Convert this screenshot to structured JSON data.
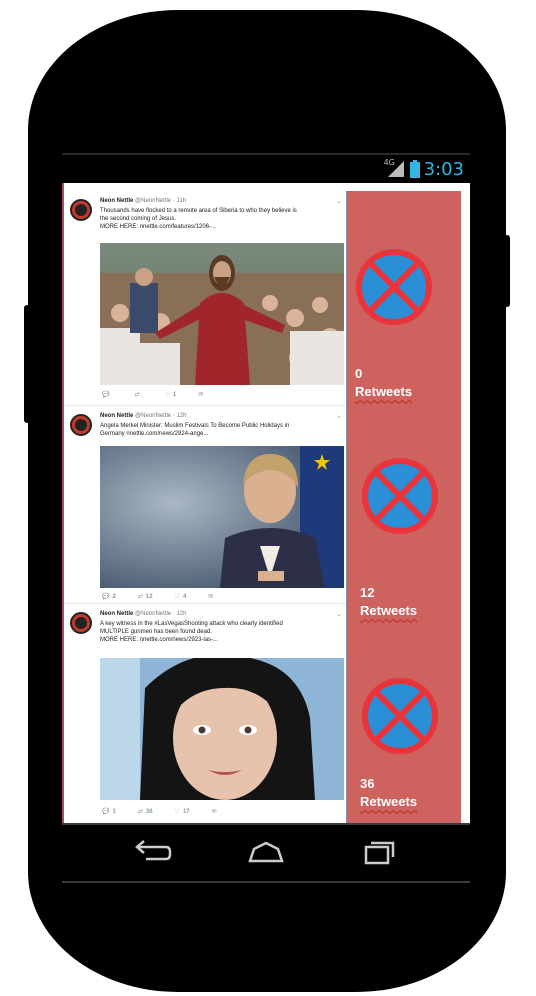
{
  "status_bar": {
    "network": "4G",
    "time": "3:03",
    "icons": [
      "signal-icon",
      "battery-icon"
    ],
    "clock_color": "#33b5e5"
  },
  "tweets": [
    {
      "author": "Neon Nettle",
      "handle": "@NeonNettle · 11h",
      "text_lines": [
        "Thousands have flocked to a remote area of Siberia to who they believe is",
        "the second coming of Jesus.",
        "MORE HERE: nnettle.com/features/1206-..."
      ],
      "actions": {
        "reply": "",
        "retweet": "",
        "like": "1"
      }
    },
    {
      "author": "Neon Nettle",
      "handle": "@NeonNettle · 12h",
      "text_lines": [
        "Angela Merkel Minister: Muslim Festivals To Become Public Holidays in",
        "Germany nnettle.com/news/2924-ange..."
      ],
      "actions": {
        "reply": "2",
        "retweet": "12",
        "like": "4"
      }
    },
    {
      "author": "Neon Nettle",
      "handle": "@NeonNettle · 12h",
      "text_lines": [
        "A key witness in the #LasVegasShooting attack who clearly identified",
        "MULTIPLE gunmen has been found dead.",
        "MORE HERE: nnettle.com/news/2923-las-..."
      ],
      "actions": {
        "reply": "1",
        "retweet": "36",
        "like": "17"
      }
    }
  ],
  "retweet_panel": {
    "background": "#cd625e",
    "icon": "no-parking-icon",
    "items": [
      {
        "count": "0",
        "label": "Retweets"
      },
      {
        "count": "12",
        "label": "Retweets"
      },
      {
        "count": "36",
        "label": "Retweets"
      }
    ]
  },
  "nav_bar": {
    "buttons": [
      "back-icon",
      "home-icon",
      "recent-apps-icon"
    ]
  }
}
